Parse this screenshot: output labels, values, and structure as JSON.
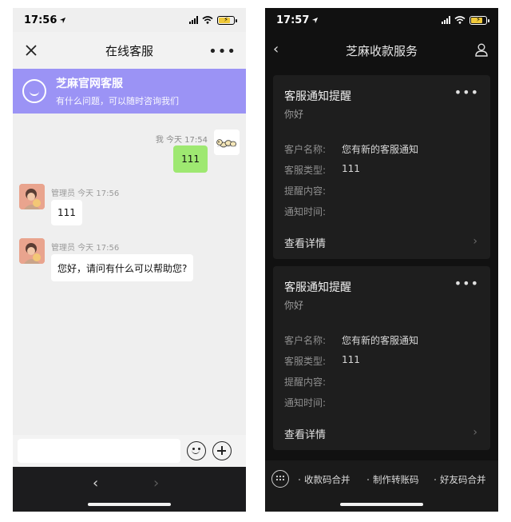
{
  "left_screen": {
    "status_time": "17:56",
    "nav_title": "在线客服",
    "banner": {
      "title": "芝麻官网客服",
      "subtitle": "有什么问题，可以随时咨询我们"
    },
    "self_message": {
      "meta": "我 今天 17:54",
      "text": "111"
    },
    "admin_messages": [
      {
        "meta": "管理员 今天 17:56",
        "text": "111"
      },
      {
        "meta": "管理员 今天 17:56",
        "text": "您好，请问有什么可以帮助您?"
      }
    ],
    "icons": {
      "close": "close-icon",
      "more": "more-icon",
      "emoji": "emoji-icon",
      "plus": "plus-icon",
      "back": "back-icon",
      "forward": "forward-icon"
    }
  },
  "right_screen": {
    "status_time": "17:57",
    "nav_title": "芝麻收款服务",
    "cards": [
      {
        "title": "客服通知提醒",
        "subtitle": "你好",
        "rows": [
          {
            "key": "客户名称:",
            "value": "您有新的客服通知"
          },
          {
            "key": "客服类型:",
            "value": "111"
          },
          {
            "key": "提醒内容:",
            "value": ""
          },
          {
            "key": "通知时间:",
            "value": ""
          }
        ],
        "detail": "查看详情"
      },
      {
        "title": "客服通知提醒",
        "subtitle": "你好",
        "rows": [
          {
            "key": "客户名称:",
            "value": "您有新的客服通知"
          },
          {
            "key": "客服类型:",
            "value": "111"
          },
          {
            "key": "提醒内容:",
            "value": ""
          },
          {
            "key": "通知时间:",
            "value": ""
          }
        ],
        "detail": "查看详情"
      }
    ],
    "menu": [
      "收款码合并",
      "制作转账码",
      "好友码合并"
    ]
  },
  "colors": {
    "banner": "#9b93f5",
    "self_bubble": "#9ee871",
    "dark_bg": "#111111",
    "card_bg": "#1e1e1e"
  }
}
